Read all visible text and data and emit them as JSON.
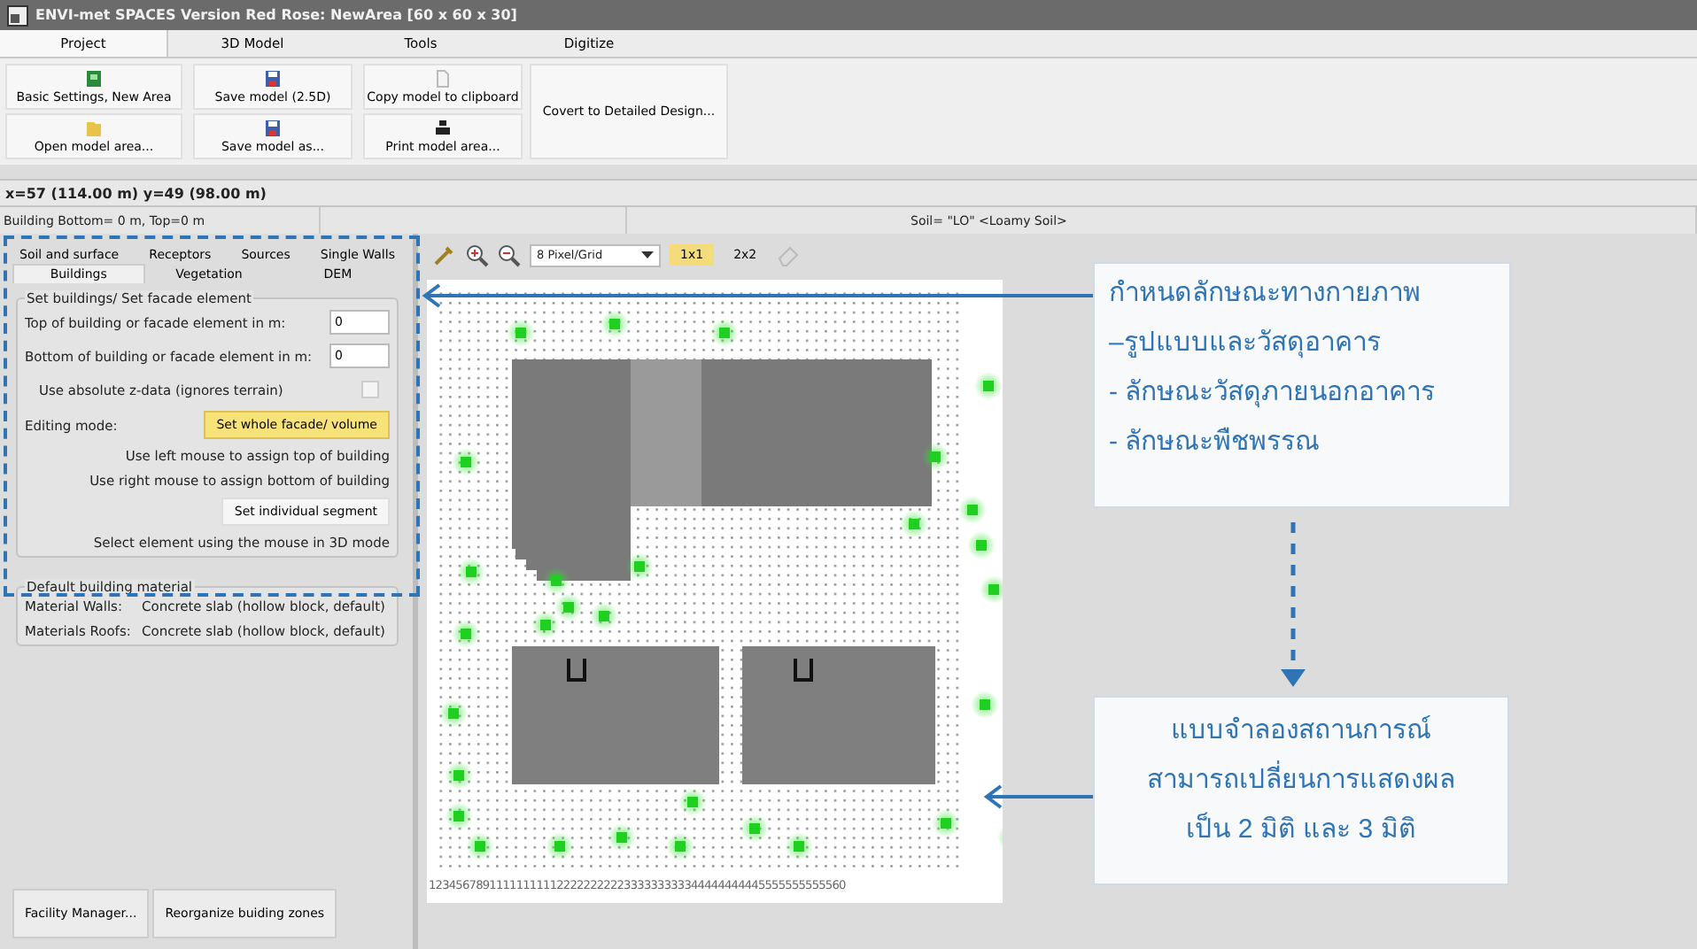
{
  "window": {
    "title": "ENVI-met SPACES Version Red Rose: NewArea [60 x 60 x 30]"
  },
  "menu_tabs": [
    {
      "label": "Project",
      "selected": true
    },
    {
      "label": "3D Model",
      "selected": false
    },
    {
      "label": "Tools",
      "selected": false
    },
    {
      "label": "Digitize",
      "selected": false
    }
  ],
  "ribbon": {
    "buttons": [
      {
        "label": "Basic Settings, New Area"
      },
      {
        "label": "Save model (2.5D)"
      },
      {
        "label": "Copy model to clipboard"
      },
      {
        "label": "Open model area..."
      },
      {
        "label": "Save model as..."
      },
      {
        "label": "Print model area..."
      }
    ],
    "wide_button": "Covert to Detailed Design..."
  },
  "coordinates": "x=57 (114.00 m) y=49 (98.00 m)",
  "status_bar": {
    "left": "Building Bottom= 0 m, Top=0 m",
    "right": "Soil= \"LO\" <Loamy Soil>"
  },
  "left_panel": {
    "tab_rows": [
      [
        {
          "label": "Soil and surface",
          "selected": false
        },
        {
          "label": "Receptors",
          "selected": false
        },
        {
          "label": "Sources",
          "selected": false
        },
        {
          "label": "Single Walls",
          "selected": false
        }
      ],
      [
        {
          "label": "Buildings",
          "selected": true
        },
        {
          "label": "Vegetation",
          "selected": false
        },
        {
          "label": "DEM",
          "selected": false
        }
      ]
    ],
    "group_title": "Set buildings/ Set facade element",
    "fields": [
      {
        "label": "Top of building or facade element in m:",
        "value": "0"
      },
      {
        "label": "Bottom of building or facade element in m:",
        "value": "0"
      }
    ],
    "checkbox": {
      "label": "Use absolute z-data (ignores terrain)",
      "checked": false
    },
    "editing_label": "Editing mode:",
    "modes": [
      {
        "label": "Set whole facade/ volume",
        "selected": true
      },
      {
        "label": "Set individual segment",
        "selected": false
      }
    ],
    "hints": [
      "Use left mouse to assign top of building",
      "Use right mouse to assign bottom of building"
    ],
    "note": "Select element using the mouse in 3D mode",
    "material_title": "Default building material",
    "materials": [
      {
        "label": "Material Walls:",
        "value": "Concrete slab (hollow block, default)"
      },
      {
        "label": "Materials Roofs:",
        "value": "Concrete slab (hollow block, default)"
      }
    ],
    "bottom_buttons": [
      "Facility Manager...",
      "Reorganize buiding zones"
    ]
  },
  "toolbar": {
    "zoom_select": "8 Pixel/Grid",
    "view_buttons": [
      {
        "label": "1x1",
        "selected": true
      },
      {
        "label": "2x2",
        "selected": false
      }
    ]
  },
  "grid": {
    "x_axis": "12345678911111111112222222222333333333344444444445555555555560"
  },
  "callouts": [
    {
      "lines": [
        "กำหนดลักษณะทางกายภาพ",
        "–รูปแบบและวัสดุอาคาร",
        "- ลักษณะวัสดุภายนอกอาคาร",
        "- ลักษณะพืชพรรณ"
      ]
    },
    {
      "lines": [
        "แบบจำลองสถานการณ์",
        "สามารถเปลี่ยนการแสดงผล",
        "เป็น 2 มิติ และ 3 มิติ"
      ]
    }
  ]
}
